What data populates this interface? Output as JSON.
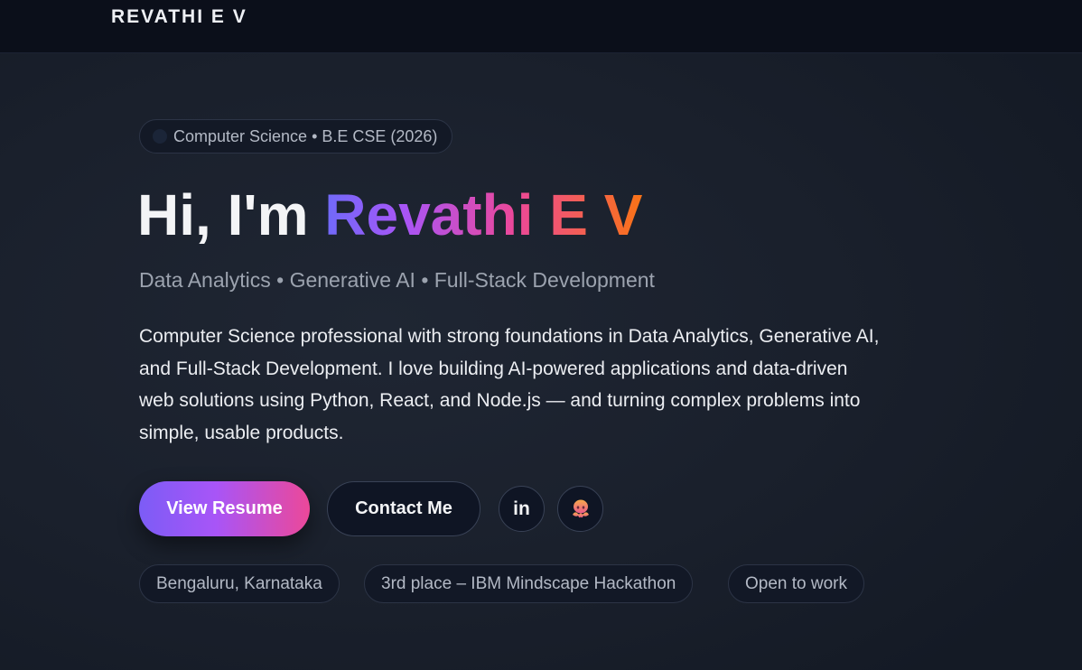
{
  "header": {
    "brand": "REVATHI E V"
  },
  "hero": {
    "badge": "Computer Science • B.E CSE (2026)",
    "greeting": "Hi, I'm ",
    "name": "Revathi E V",
    "subtitle": "Data Analytics • Generative AI • Full-Stack Development",
    "bio": "Computer Science professional with strong foundations in Data Analytics, Generative AI, and Full-Stack Development. I love building AI-powered applications and data-driven web solutions using Python, React, and Node.js — and turning complex problems into simple, usable products.",
    "primary_button": "View Resume",
    "secondary_button": "Contact Me",
    "linkedin_label": "in",
    "chips": [
      "Bengaluru, Karnataka",
      "3rd place – IBM Mindscape Hackathon",
      "Open to work"
    ]
  },
  "icons": {
    "linkedin": "linkedin-icon",
    "github": "github-octocat-icon"
  },
  "colors": {
    "background": "#151b27",
    "topbar": "#0b0f1a",
    "gradient_start": "#6f6af8",
    "gradient_mid": "#ec4899",
    "gradient_end": "#f97316"
  }
}
